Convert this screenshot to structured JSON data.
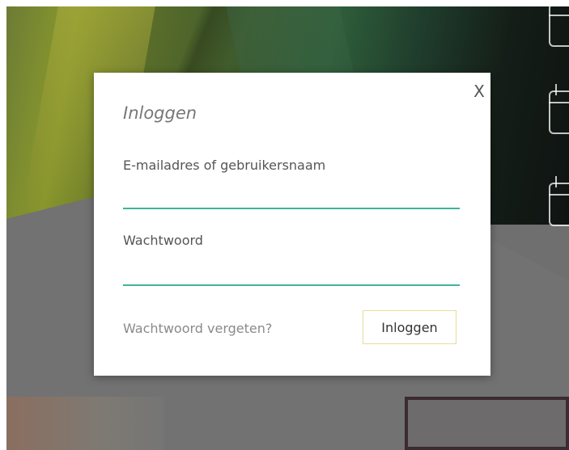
{
  "dialog": {
    "close_label": "X",
    "title": "Inloggen",
    "email_label": "E-mailadres of gebruikersnaam",
    "email_value": "",
    "password_label": "Wachtwoord",
    "password_value": "",
    "forgot_label": "Wachtwoord vergeten?",
    "submit_label": "Inloggen"
  },
  "colors": {
    "input_underline": "#3fb39a",
    "button_border": "#e8dd9a",
    "overlay": "#6f6f6f"
  },
  "icons": [
    "calendar-icon",
    "calendar-icon",
    "calendar-icon"
  ]
}
